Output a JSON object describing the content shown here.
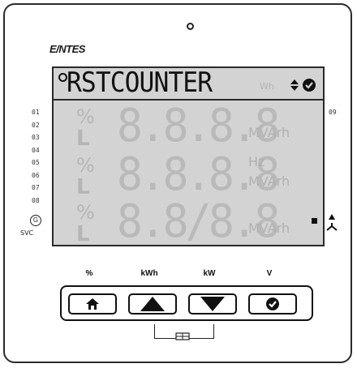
{
  "brand": {
    "name": "E/NTES"
  },
  "lcd": {
    "message": "RSTCOUNTER",
    "ghost_unit": "Wh",
    "rows": [
      {
        "prefix": "%",
        "line": "L",
        "digits": "8.8.8.8",
        "unit_top": "",
        "unit_bottom": "MVArh"
      },
      {
        "prefix": "%",
        "line": "L",
        "digits": "8.8.8.8",
        "unit_top": "Hz",
        "unit_bottom": "MVArh"
      },
      {
        "prefix": "%",
        "line": "L",
        "digits": "8.8/8.8",
        "unit_top": "",
        "unit_bottom": "MVArh"
      }
    ]
  },
  "channels": [
    "01",
    "02",
    "03",
    "04",
    "05",
    "06",
    "07",
    "08"
  ],
  "channel_right": "09",
  "g_label": "G",
  "svc_label": "SVC",
  "buttons": {
    "labels": [
      "%",
      "kWh",
      "kW",
      "V"
    ],
    "keys": [
      "home-icon",
      "up-triangle-icon",
      "down-triangle-icon",
      "check-circle-icon"
    ]
  },
  "colors": {
    "lcd_bg": "#d3d3d3",
    "lcd_ink": "#111111",
    "ghost": "#b9b9b9"
  }
}
